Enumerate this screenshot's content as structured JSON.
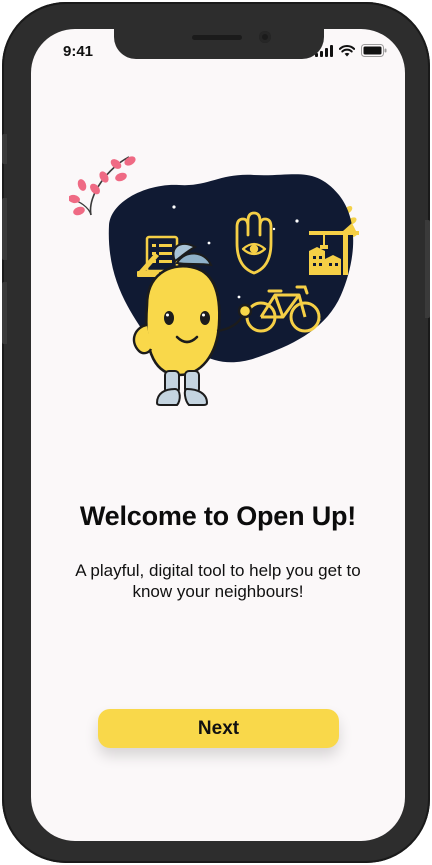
{
  "status_bar": {
    "time": "9:41",
    "icons": [
      "signal-icon",
      "wifi-icon",
      "battery-icon"
    ]
  },
  "onboarding": {
    "title": "Welcome to Open Up!",
    "subtitle": "A playful, digital tool to help you get to know your neighbours!",
    "next_label": "Next"
  },
  "colors": {
    "screen_background": "#fbf8f9",
    "accent_yellow": "#f9d84a",
    "illustration_navy": "#101a33",
    "leaf_pink": "#ef6a84",
    "device_frame": "#2d2d2d"
  }
}
